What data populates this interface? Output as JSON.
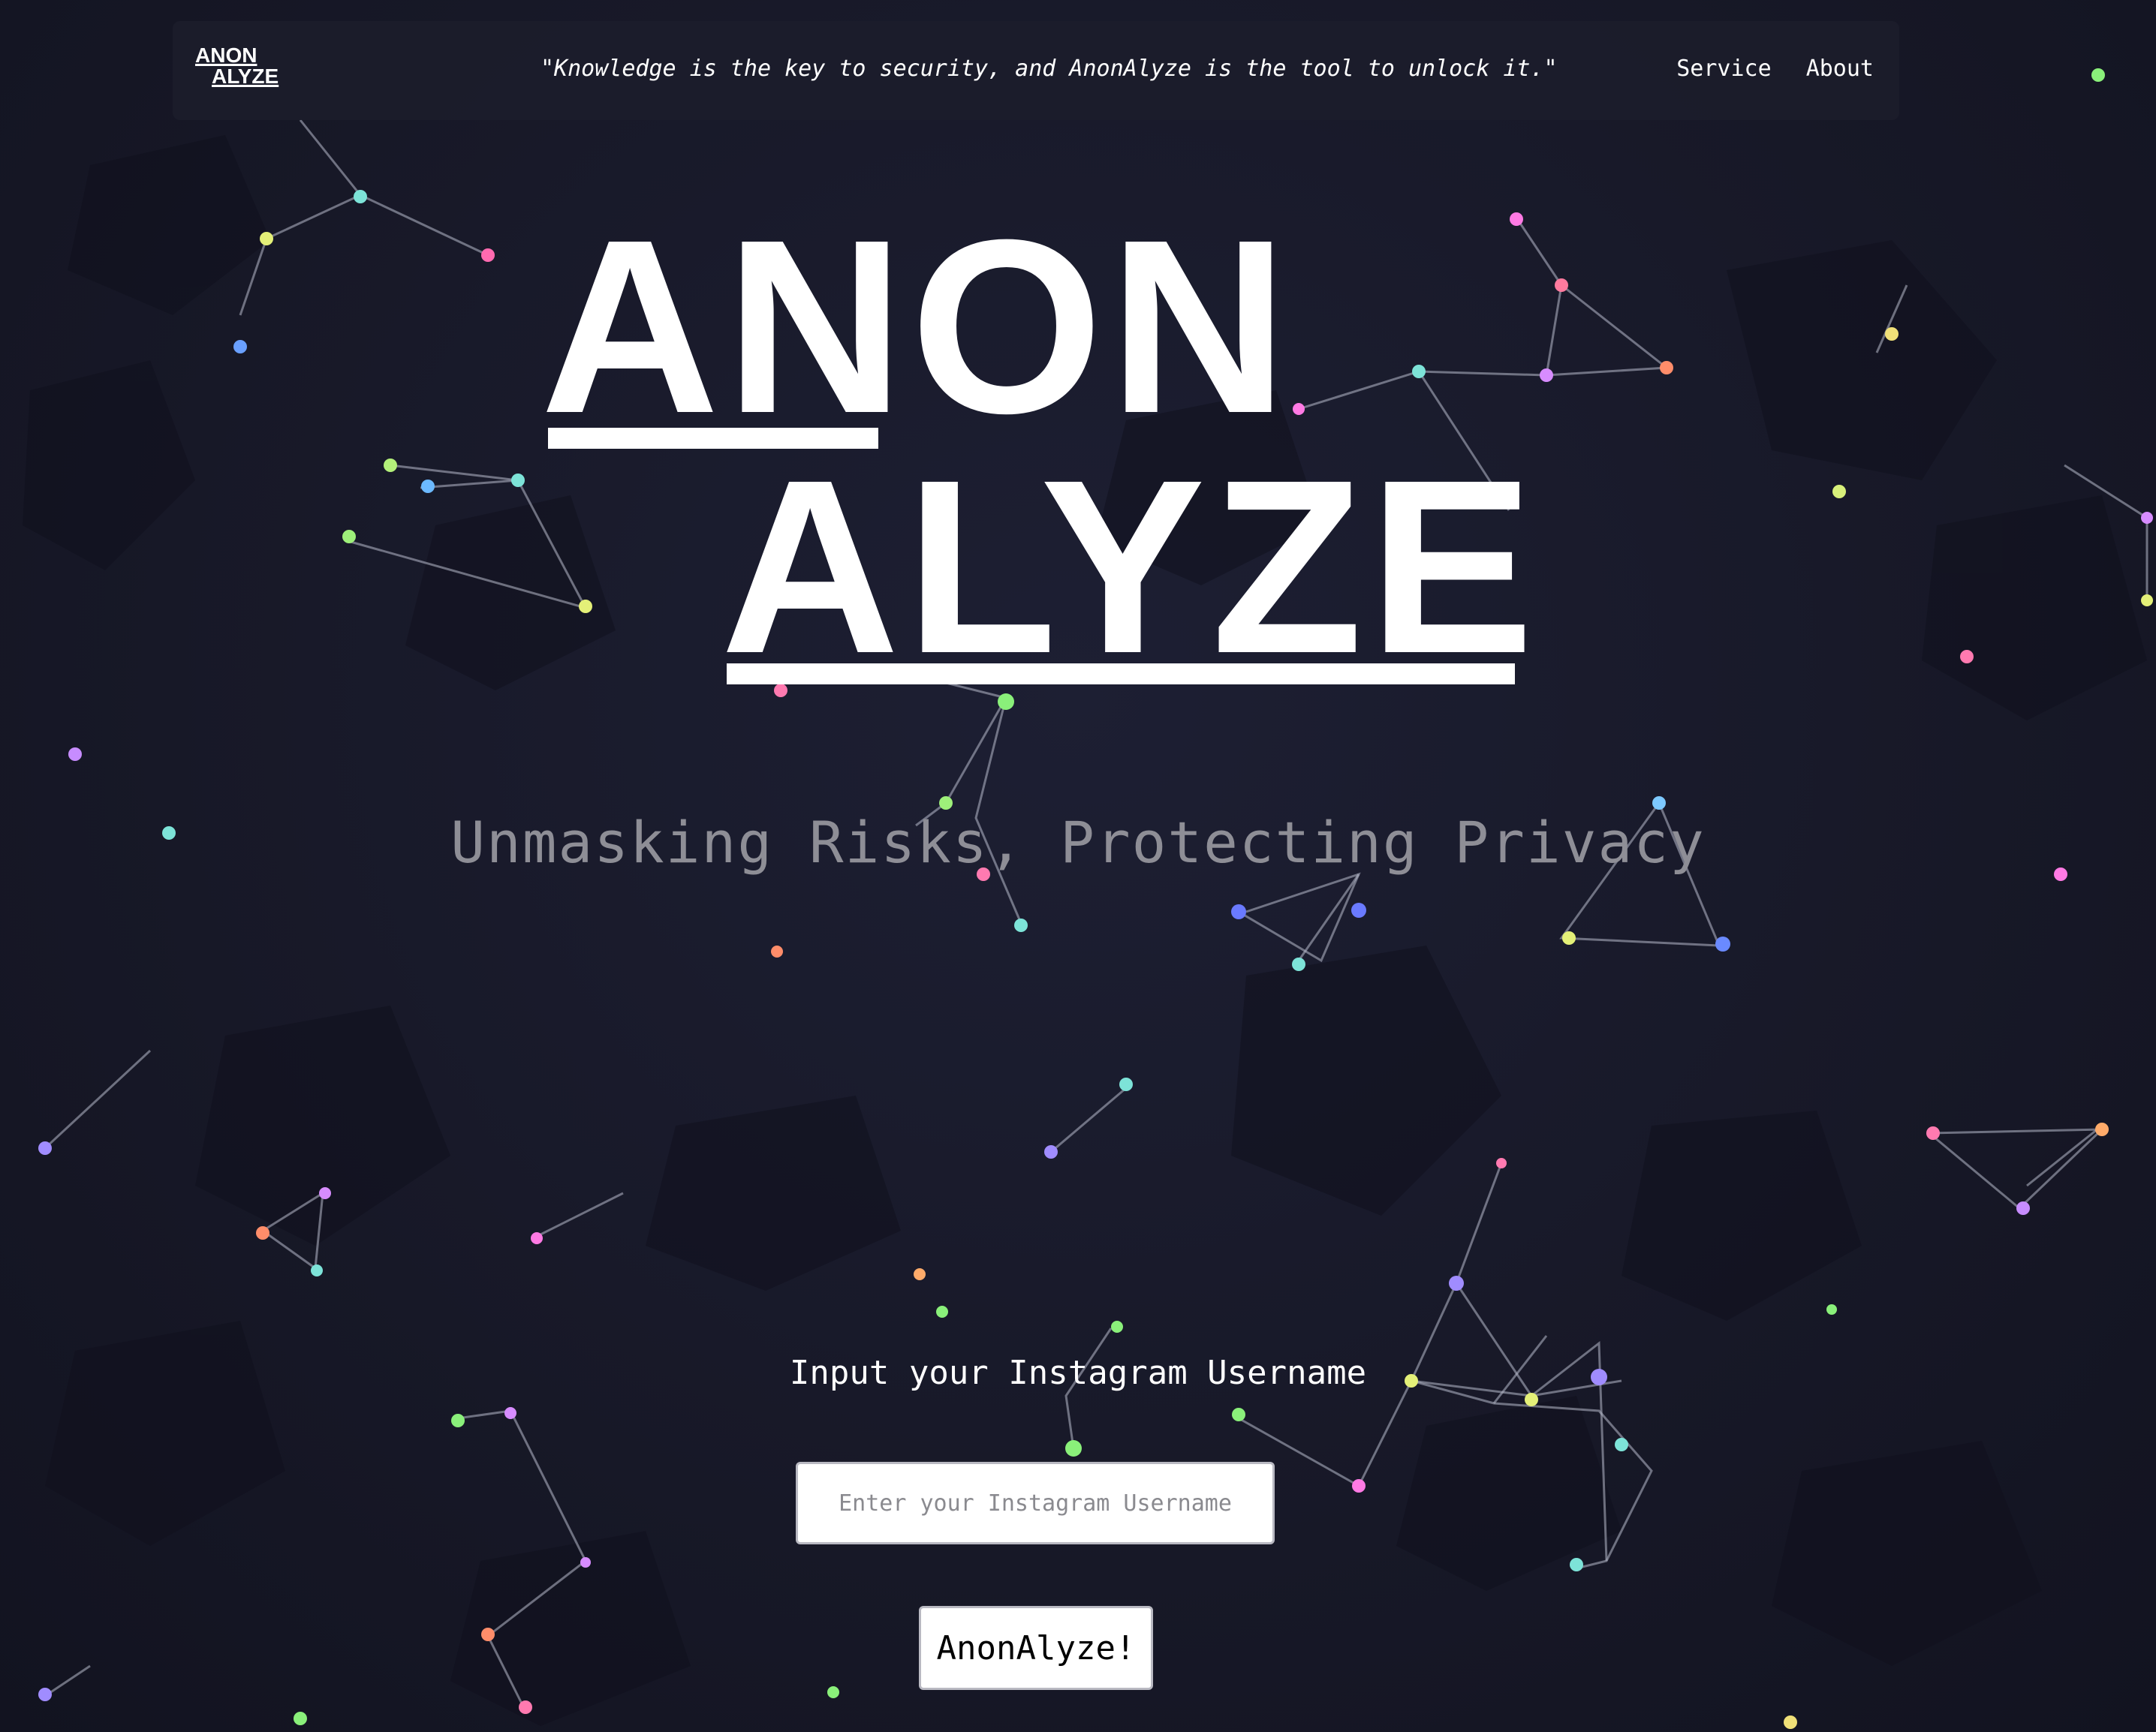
{
  "nav": {
    "logo_line1": "ANON",
    "logo_line2": "ALYZE",
    "quote": "\"Knowledge is the key to security, and AnonAlyze is the tool to unlock it.\"",
    "links": [
      "Service",
      "About"
    ]
  },
  "hero": {
    "logo_line1": "ANON",
    "logo_line2": "ALYZE",
    "tagline": "Unmasking Risks, Protecting Privacy"
  },
  "form": {
    "label": "Input your Instagram Username",
    "placeholder": "Enter your Instagram Username",
    "value": "",
    "submit_label": "AnonAlyze!"
  },
  "colors": {
    "background": "#181a2b",
    "text": "#ffffff",
    "tagline": "#8e8e96"
  }
}
